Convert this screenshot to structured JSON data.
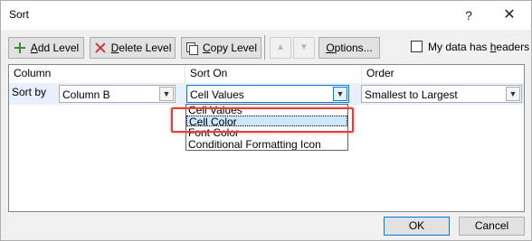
{
  "window": {
    "title": "Sort",
    "help_glyph": "?",
    "close_glyph": "✕"
  },
  "toolbar": {
    "add_level": {
      "underline": "A",
      "rest": "dd Level"
    },
    "delete_level": {
      "underline": "D",
      "rest": "elete Level"
    },
    "copy_level": {
      "underline": "C",
      "rest": "opy Level"
    },
    "move_up_glyph": "▲",
    "move_down_glyph": "▼",
    "options": {
      "underline": "O",
      "rest": "ptions..."
    },
    "headers_checkbox": {
      "label_pre": "My data has ",
      "underline": "h",
      "label_post": "eaders",
      "checked": false
    }
  },
  "grid": {
    "headers": [
      "Column",
      "Sort On",
      "Order"
    ],
    "row": {
      "label": "Sort by",
      "column_value": "Column B",
      "sort_on_value": "Cell Values",
      "order_value": "Smallest to Largest"
    },
    "sort_on_options": [
      {
        "label": "Cell Values",
        "selected": false
      },
      {
        "label": "Cell Color",
        "selected": true
      },
      {
        "label": "Font Color",
        "selected": false
      },
      {
        "label": "Conditional Formatting Icon",
        "selected": false
      }
    ]
  },
  "footer": {
    "ok": "OK",
    "cancel": "Cancel"
  },
  "colors": {
    "highlight": "#e0413f",
    "selection": "#cce8ff",
    "accent": "#0078d7"
  }
}
